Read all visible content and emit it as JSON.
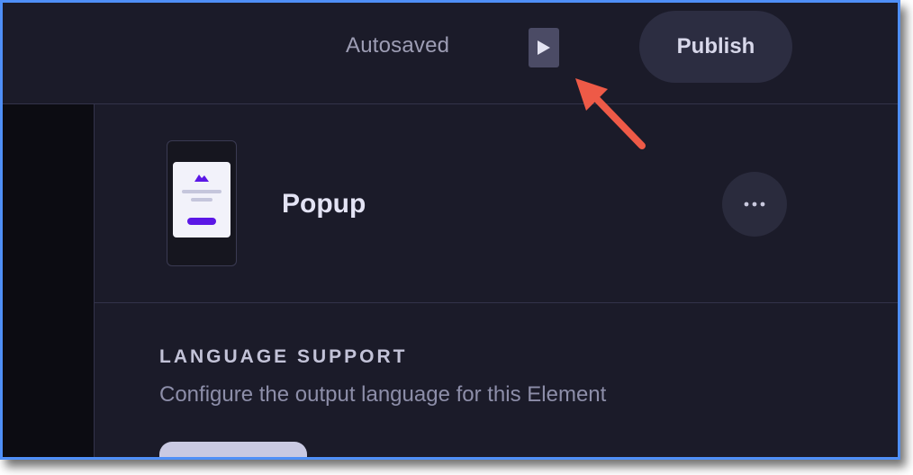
{
  "header": {
    "status_text": "Autosaved",
    "preview_icon": "play-triangle-icon",
    "publish_label": "Publish"
  },
  "element": {
    "name": "Popup",
    "thumbnail_icon": "popup-thumbnail-icon",
    "more_icon": "more-horizontal-icon"
  },
  "language": {
    "title": "LANGUAGE SUPPORT",
    "description": "Configure the output language for this Element"
  },
  "annotation": {
    "arrow_icon": "red-pointer-arrow",
    "color": "#ee5a47"
  },
  "colors": {
    "background": "#1b1b29",
    "accent": "#5b17e6",
    "frame_border": "#4f8ff7"
  }
}
